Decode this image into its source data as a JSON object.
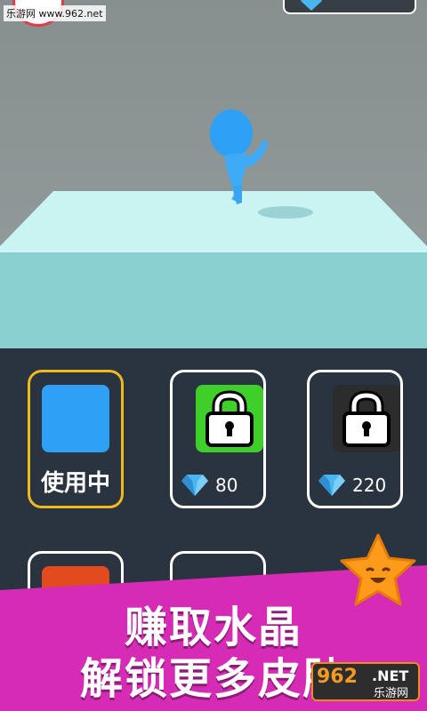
{
  "watermark": {
    "site": "乐游网 www.962.net",
    "bottom_number": "962",
    "bottom_domain": ".NET",
    "bottom_cn": "乐游网"
  },
  "colors": {
    "selected_border": "#f0b91d",
    "skin_blue": "#2ea0f5",
    "lock_green": "#3ecf2b",
    "lock_dark": "#2c2c2c",
    "banner": "#d62bb5",
    "panel": "#2a3441"
  },
  "skins": [
    {
      "status": "使用中",
      "swatch": "#2ea0f5",
      "locked": false,
      "selected": true
    },
    {
      "price": "80",
      "lock_bg": "#3ecf2b",
      "locked": true,
      "selected": false
    },
    {
      "price": "220",
      "lock_bg": "#2c2c2c",
      "locked": true,
      "selected": false
    }
  ],
  "banner": {
    "line1": "赚取水晶",
    "line2": "解锁更多皮肤"
  }
}
